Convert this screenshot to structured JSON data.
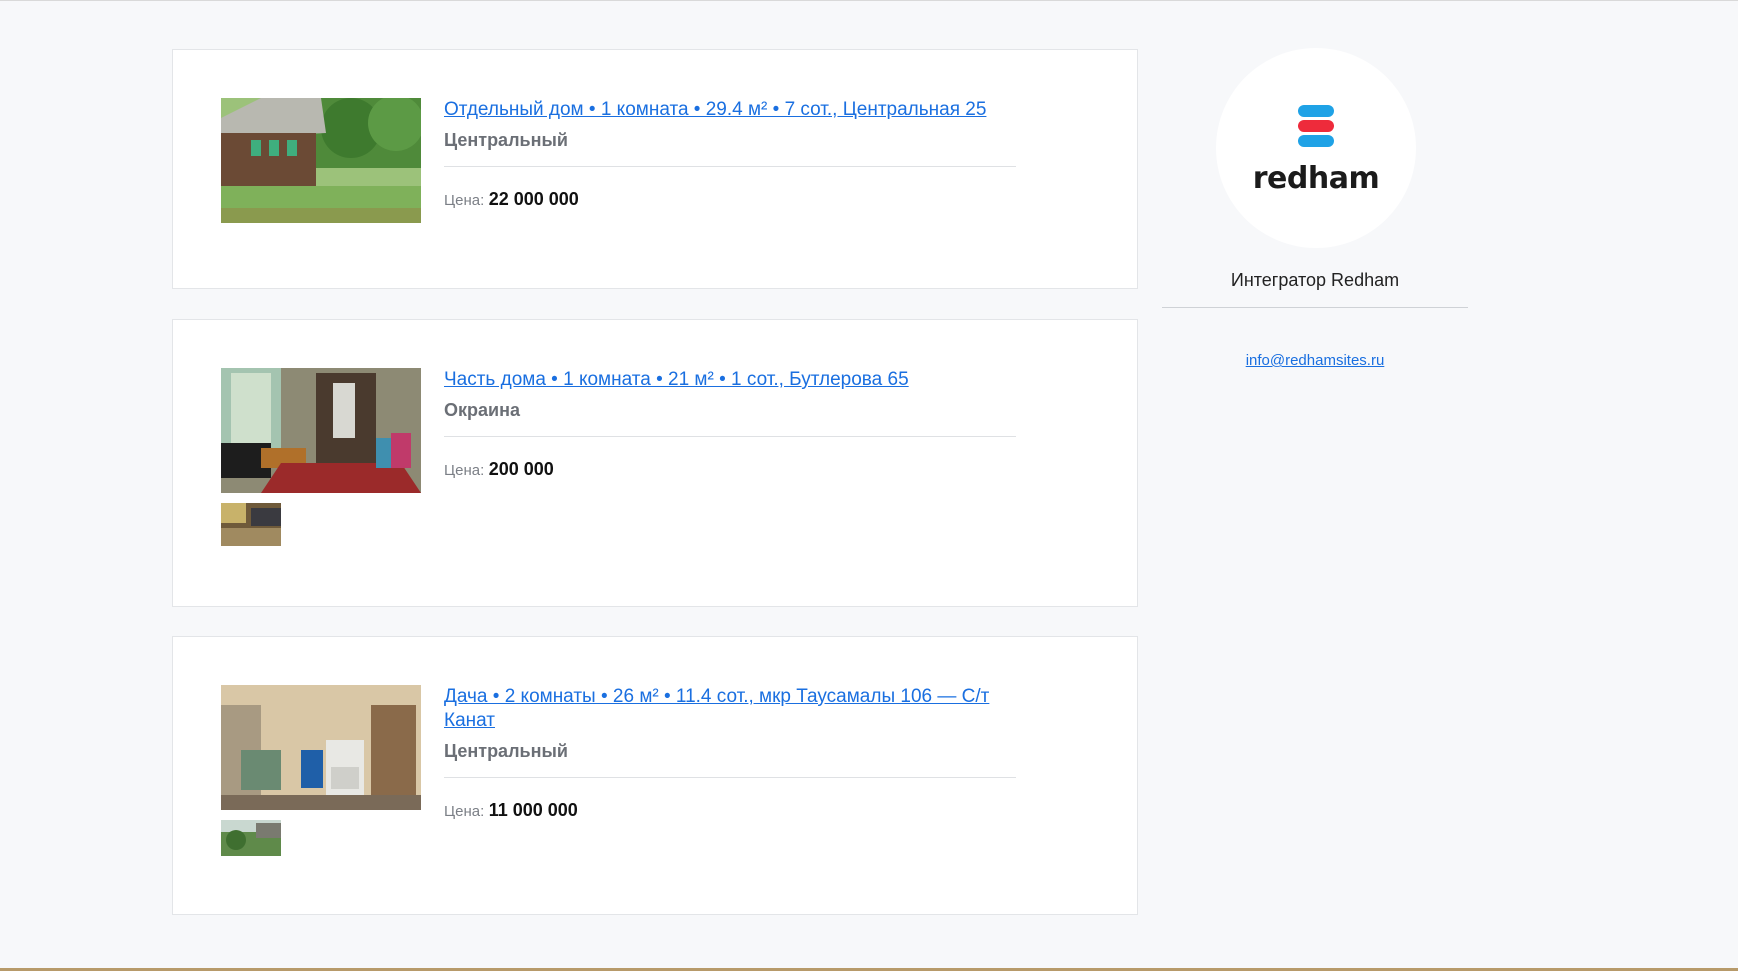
{
  "listings": [
    {
      "title": "Отдельный дом • 1 комната • 29.4 м² • 7 сот., Центральная 25",
      "district": "Центральный",
      "price_label": "Цена:",
      "price": "22 000 000"
    },
    {
      "title": "Часть дома • 1 комната • 21 м² • 1 сот., Бутлерова 65",
      "district": "Окраина",
      "price_label": "Цена:",
      "price": "200 000"
    },
    {
      "title": "Дача • 2 комнаты • 26 м² • 11.4 сот., мкр Таусамалы 106 — С/т Канат",
      "district": "Центральный",
      "price_label": "Цена:",
      "price": "11 000 000"
    }
  ],
  "agent": {
    "logo_text": "redham",
    "name": "Интегратор Redham",
    "email": "info@redhamsites.ru",
    "colors": {
      "logo_blue": "#1fa2e6",
      "logo_red": "#ee2b3b"
    }
  }
}
